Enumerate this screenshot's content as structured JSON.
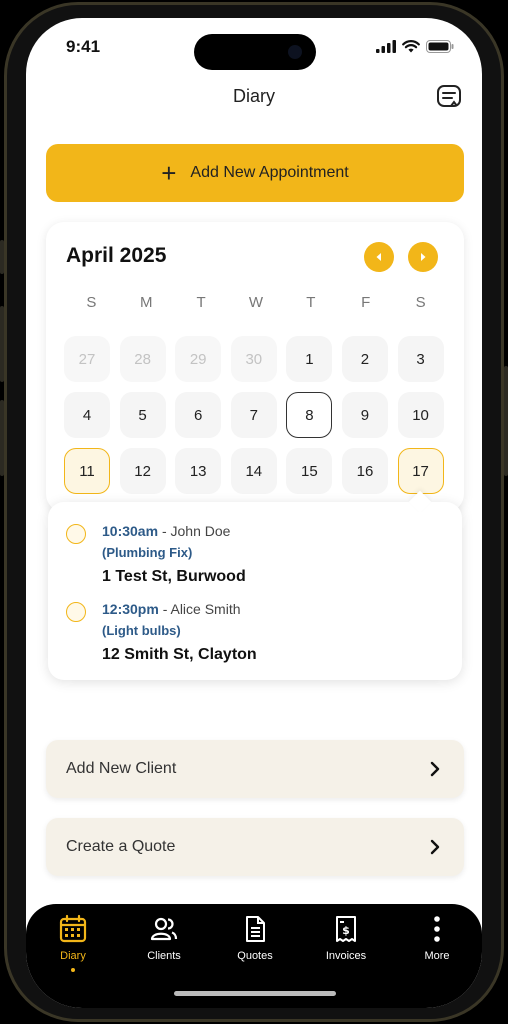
{
  "status": {
    "time": "9:41"
  },
  "header": {
    "title": "Diary"
  },
  "add_appointment": {
    "label": "Add New Appointment"
  },
  "calendar": {
    "month": "April 2025",
    "weekdays": [
      "S",
      "M",
      "T",
      "W",
      "T",
      "F",
      "S"
    ],
    "days": [
      {
        "label": "27",
        "state": "muted"
      },
      {
        "label": "28",
        "state": "muted"
      },
      {
        "label": "29",
        "state": "muted"
      },
      {
        "label": "30",
        "state": "muted"
      },
      {
        "label": "1",
        "state": ""
      },
      {
        "label": "2",
        "state": ""
      },
      {
        "label": "3",
        "state": ""
      },
      {
        "label": "4",
        "state": ""
      },
      {
        "label": "5",
        "state": ""
      },
      {
        "label": "6",
        "state": ""
      },
      {
        "label": "7",
        "state": ""
      },
      {
        "label": "8",
        "state": "today"
      },
      {
        "label": "9",
        "state": ""
      },
      {
        "label": "10",
        "state": ""
      },
      {
        "label": "11",
        "state": "has-appt"
      },
      {
        "label": "12",
        "state": ""
      },
      {
        "label": "13",
        "state": ""
      },
      {
        "label": "14",
        "state": ""
      },
      {
        "label": "15",
        "state": ""
      },
      {
        "label": "16",
        "state": ""
      },
      {
        "label": "17",
        "state": "has-appt"
      }
    ]
  },
  "appointments": [
    {
      "time": "10:30am",
      "client": "John Doe",
      "service": "(Plumbing Fix)",
      "address": "1 Test St, Burwood"
    },
    {
      "time": "12:30pm",
      "client": "Alice Smith",
      "service": "(Light bulbs)",
      "address": "12 Smith St, Clayton"
    }
  ],
  "actions": {
    "add_client": "Add New Client",
    "create_quote": "Create a Quote"
  },
  "tabs": [
    {
      "label": "Diary",
      "icon": "calendar-icon",
      "active": true
    },
    {
      "label": "Clients",
      "icon": "clients-icon",
      "active": false
    },
    {
      "label": "Quotes",
      "icon": "document-icon",
      "active": false
    },
    {
      "label": "Invoices",
      "icon": "invoice-icon",
      "active": false
    },
    {
      "label": "More",
      "icon": "more-icon",
      "active": false
    }
  ],
  "colors": {
    "accent": "#f2b619",
    "link": "#2d5a88",
    "action_bg": "#f5f1e8"
  }
}
